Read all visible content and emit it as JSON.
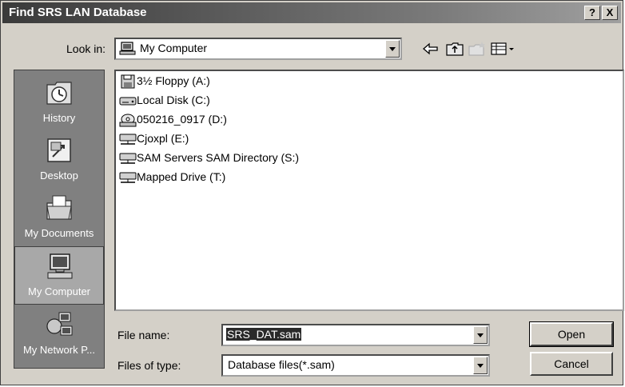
{
  "window": {
    "title": "Find SRS LAN Database",
    "help_label": "?",
    "close_label": "X"
  },
  "lookin": {
    "label": "Look in:",
    "value": "My Computer"
  },
  "places": [
    {
      "label": "History",
      "icon": "history-icon"
    },
    {
      "label": "Desktop",
      "icon": "desktop-icon"
    },
    {
      "label": "My Documents",
      "icon": "my-documents-icon"
    },
    {
      "label": "My Computer",
      "icon": "my-computer-icon",
      "selected": true
    },
    {
      "label": "My Network P...",
      "icon": "my-network-places-icon"
    }
  ],
  "files": [
    {
      "name": "3½ Floppy (A:)",
      "icon": "floppy-drive-icon"
    },
    {
      "name": "Local Disk (C:)",
      "icon": "hard-disk-icon"
    },
    {
      "name": "050216_0917 (D:)",
      "icon": "cd-drive-icon"
    },
    {
      "name": "Cjoxpl (E:)",
      "icon": "network-drive-icon"
    },
    {
      "name": "SAM Servers SAM Directory (S:)",
      "icon": "network-drive-icon"
    },
    {
      "name": "Mapped Drive (T:)",
      "icon": "network-drive-icon"
    }
  ],
  "filename": {
    "label": "File name:",
    "value": "SRS_DAT.sam"
  },
  "filetype": {
    "label": "Files of type:",
    "value": "Database files(*.sam)"
  },
  "buttons": {
    "open": "Open",
    "cancel": "Cancel"
  }
}
